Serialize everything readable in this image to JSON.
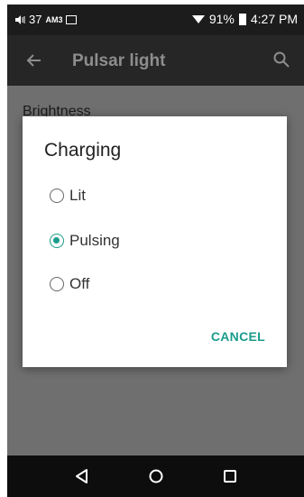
{
  "status_bar": {
    "volume_value": "37",
    "network": "AM3",
    "battery": "91%",
    "time": "4:27 PM",
    "icons": [
      "volume-icon",
      "image-icon",
      "wifi-icon",
      "battery-icon"
    ]
  },
  "app_bar": {
    "title": "Pulsar light",
    "icons": [
      "back-arrow-icon",
      "search-icon"
    ]
  },
  "background": {
    "section_label": "Brightness"
  },
  "dialog": {
    "title": "Charging",
    "options": [
      {
        "label": "Lit",
        "selected": false
      },
      {
        "label": "Pulsing",
        "selected": true
      },
      {
        "label": "Off",
        "selected": false
      }
    ],
    "cancel_label": "CANCEL"
  },
  "nav_bar": {
    "icons": [
      "back-triangle-icon",
      "home-circle-icon",
      "recents-square-icon"
    ]
  },
  "colors": {
    "accent": "#1a9c8c",
    "status_bar": "#1c1c1c",
    "app_bar": "#262626",
    "scrim": "#6f6f6f",
    "nav_bar": "#0d0d0d"
  }
}
